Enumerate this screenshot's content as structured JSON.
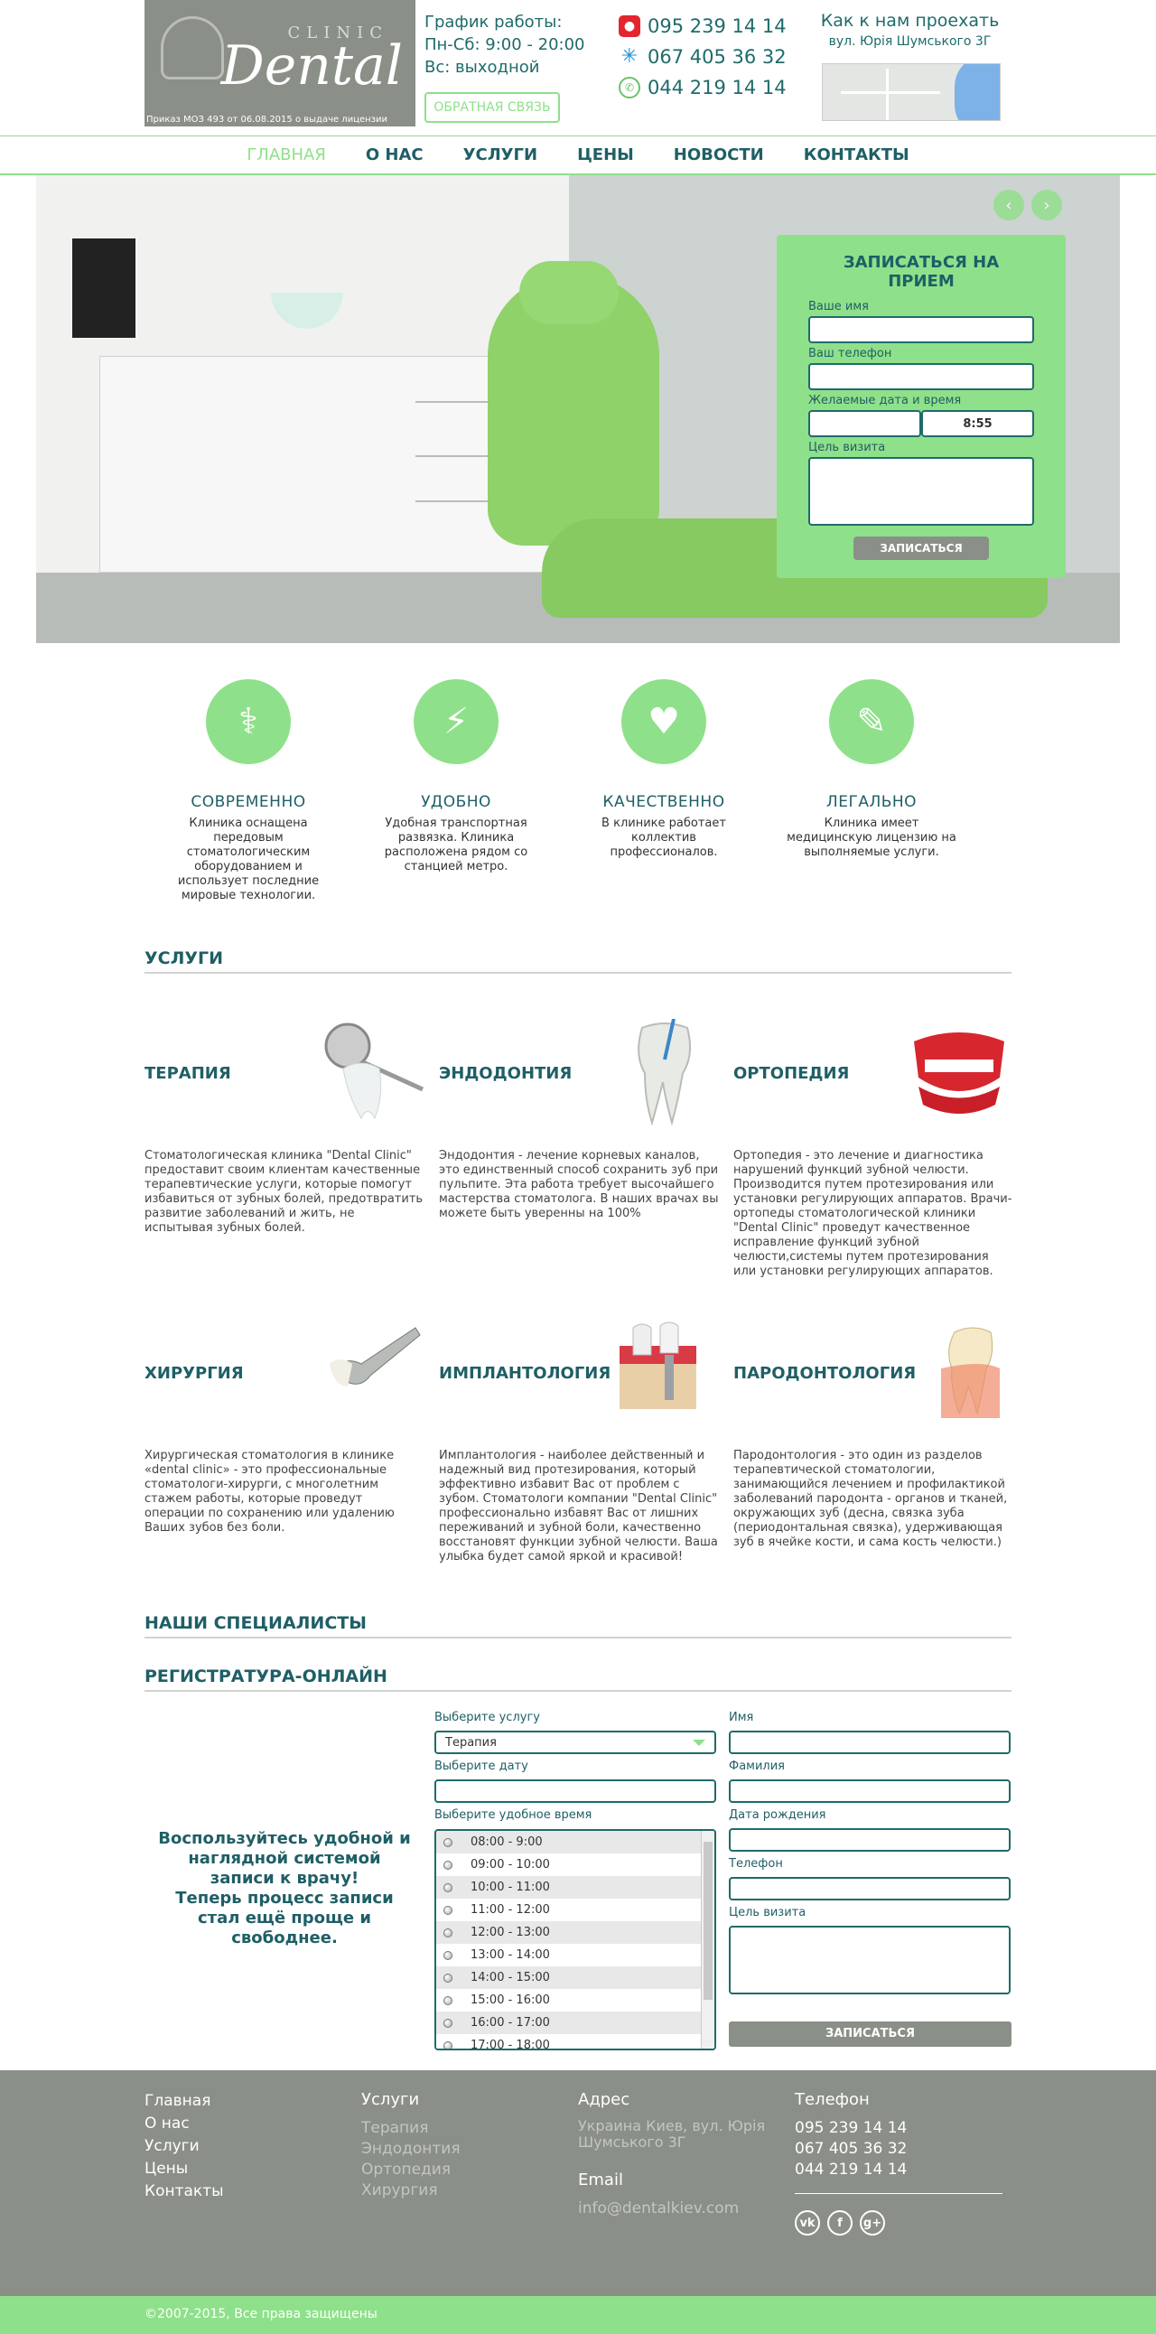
{
  "header": {
    "logo": {
      "clinic": "CLINIC",
      "name": "Dental",
      "license": "Приказ МОЗ 493 от 06.08.2015 о выдаче лицензии"
    },
    "hours": {
      "title": "График работы:",
      "weekdays": "Пн-Сб: 9:00 - 20:00",
      "weekend": "Вс: выходной"
    },
    "feedback_button": "ОБРАТНАЯ СВЯЗЬ",
    "phones": [
      "095 239 14 14",
      "067 405 36 32",
      "044 219 14 14"
    ],
    "directions": {
      "title": "Как к нам проехать",
      "address": "вул. Юрія Шумського 3Г"
    }
  },
  "nav": [
    "ГЛАВНАЯ",
    "О НАС",
    "УСЛУГИ",
    "ЦЕНЫ",
    "НОВОСТИ",
    "КОНТАКТЫ"
  ],
  "appointment": {
    "title": "ЗАПИСАТЬСЯ НА ПРИЕМ",
    "name_label": "Ваше имя",
    "phone_label": "Ваш телефон",
    "datetime_label": "Желаемые дата и время",
    "time_value": "8:55",
    "purpose_label": "Цель визита",
    "submit": "ЗАПИСАТЬСЯ"
  },
  "features": [
    {
      "title": "СОВРЕМЕННО",
      "text": "Клиника оснащена передовым стоматологическим оборудованием и использует последние мировые технологии."
    },
    {
      "title": "УДОБНО",
      "text": "Удобная транспортная развязка. Клиника расположена рядом со станцией метро."
    },
    {
      "title": "КАЧЕСТВЕННО",
      "text": "В клинике работает коллектив профессионалов."
    },
    {
      "title": "ЛЕГАЛЬНО",
      "text": "Клиника имеет медицинскую лицензию на выполняемые услуги."
    }
  ],
  "services": {
    "heading": "УСЛУГИ",
    "items": [
      {
        "title": "ТЕРАПИЯ",
        "text": "Стоматологическая клиника \"Dental Clinic\" предоставит своим клиентам качественные терапевтические услуги, которые помогут избавиться от зубных болей, предотвратить развитие заболеваний и жить, не испытывая зубных болей."
      },
      {
        "title": "ЭНДОДОНТИЯ",
        "text": "Эндодонтия - лечение корневых каналов, это единственный способ сохранить зуб при пульпите. Эта работа требует высочайшего мастерства стоматолога. В наших врачах вы можете быть уверенны на 100%"
      },
      {
        "title": "ОРТОПЕДИЯ",
        "text": "Ортопедия - это лечение и диагностика нарушений функций зубной челюсти. Производится путем протезирования или установки регулирующих аппаратов. Врачи-ортопеды стоматологической клиники \"Dental Clinic\" проведут качественное исправление функций зубной челюсти,системы путем протезирования или установки регулирующих аппаратов."
      },
      {
        "title": "ХИРУРГИЯ",
        "text": "Хирургическая стоматология в клинике «dental clinic» - это профессиональные стоматологи-хирурги, с многолетним стажем работы, которые проведут операции по сохранению или удалению Ваших зубов без боли."
      },
      {
        "title": "ИМПЛАНТОЛОГИЯ",
        "text": "Имплантология - наиболее действенный и надежный вид протезирования, который эффективно избавит Вас от проблем с зубом. Стоматологи компании \"Dental Clinic\" профессионально избавят Вас от лишних переживаний и зубной боли, качественно восстановят функции зубной челюсти. Ваша улыбка будет самой яркой и красивой!"
      },
      {
        "title": "ПАРОДОНТОЛОГИЯ",
        "text": "Пародонтология - это один из разделов терапевтической стоматологии, занимающийся лечением и профилактикой заболеваний пародонта - органов и тканей, окружающих зуб (десна, связка зуба (периодонтальная связка), удерживающая зуб в ячейке кости, и сама кость челюсти.)"
      }
    ]
  },
  "specialists_heading": "НАШИ СПЕЦИАЛИСТЫ",
  "registration": {
    "heading": "РЕГИСТРАТУРА-ОНЛАЙН",
    "promo": "Воспользуйтесь удобной и наглядной системой записи к врачу!\nТеперь процесс записи стал ещё проще и свободнее.",
    "service_label": "Выберите услугу",
    "service_value": "Терапия",
    "date_label": "Выберите дату",
    "time_label": "Выберите удобное время",
    "times": [
      "08:00 - 9:00",
      "09:00 - 10:00",
      "10:00 - 11:00",
      "11:00 - 12:00",
      "12:00 - 13:00",
      "13:00 - 14:00",
      "14:00 - 15:00",
      "15:00 - 16:00",
      "16:00 - 17:00",
      "17:00 - 18:00"
    ],
    "first_name_label": "Имя",
    "last_name_label": "Фамилия",
    "birth_label": "Дата рождения",
    "phone_label": "Телефон",
    "purpose_label": "Цель визита",
    "submit": "ЗАПИСАТЬСЯ"
  },
  "footer": {
    "links": [
      "Главная",
      "О нас",
      "Услуги",
      "Цены",
      "Контакты"
    ],
    "services_heading": "Услуги",
    "services": [
      "Терапия",
      "Эндодонтия",
      "Ортопедия",
      "Хирургия"
    ],
    "address_heading": "Адрес",
    "address": "Украина Киев, вул. Юрія Шумського 3Г",
    "email_heading": "Email",
    "email": "info@dentalkiev.com",
    "phone_heading": "Телефон",
    "phones": [
      "095 239 14 14",
      "067 405 36 32",
      "044 219 14 14"
    ],
    "copyright": "©2007-2015, Все права защищены"
  },
  "colors": {
    "accent": "#8fe08a",
    "dark": "#1f5f66",
    "gray": "#8a8f88"
  }
}
